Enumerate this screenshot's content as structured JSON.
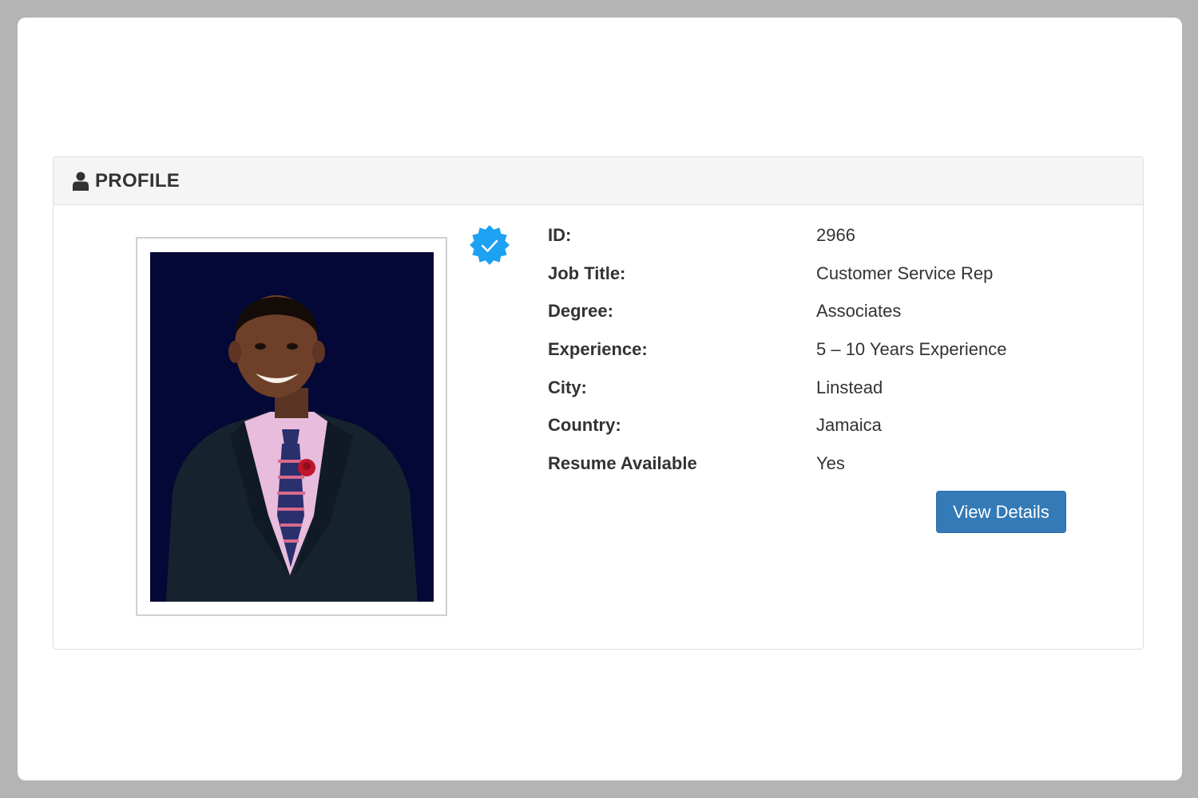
{
  "panel": {
    "title": "PROFILE",
    "icon": "user-icon"
  },
  "profile": {
    "photo_alt": "Profile photo",
    "verified_icon": "verified-badge-icon",
    "fields": [
      {
        "label": "ID:",
        "value": "2966"
      },
      {
        "label": "Job Title:",
        "value": "Customer Service Rep"
      },
      {
        "label": "Degree:",
        "value": "Associates"
      },
      {
        "label": "Experience:",
        "value": "5 – 10 Years Experience"
      },
      {
        "label": "City:",
        "value": "Linstead"
      },
      {
        "label": "Country:",
        "value": "Jamaica"
      },
      {
        "label": "Resume Available",
        "value": "Yes"
      }
    ],
    "button_label": "View Details"
  },
  "colors": {
    "accent": "#337ab7",
    "badge": "#1da1f2",
    "photo_background": "#040836"
  }
}
